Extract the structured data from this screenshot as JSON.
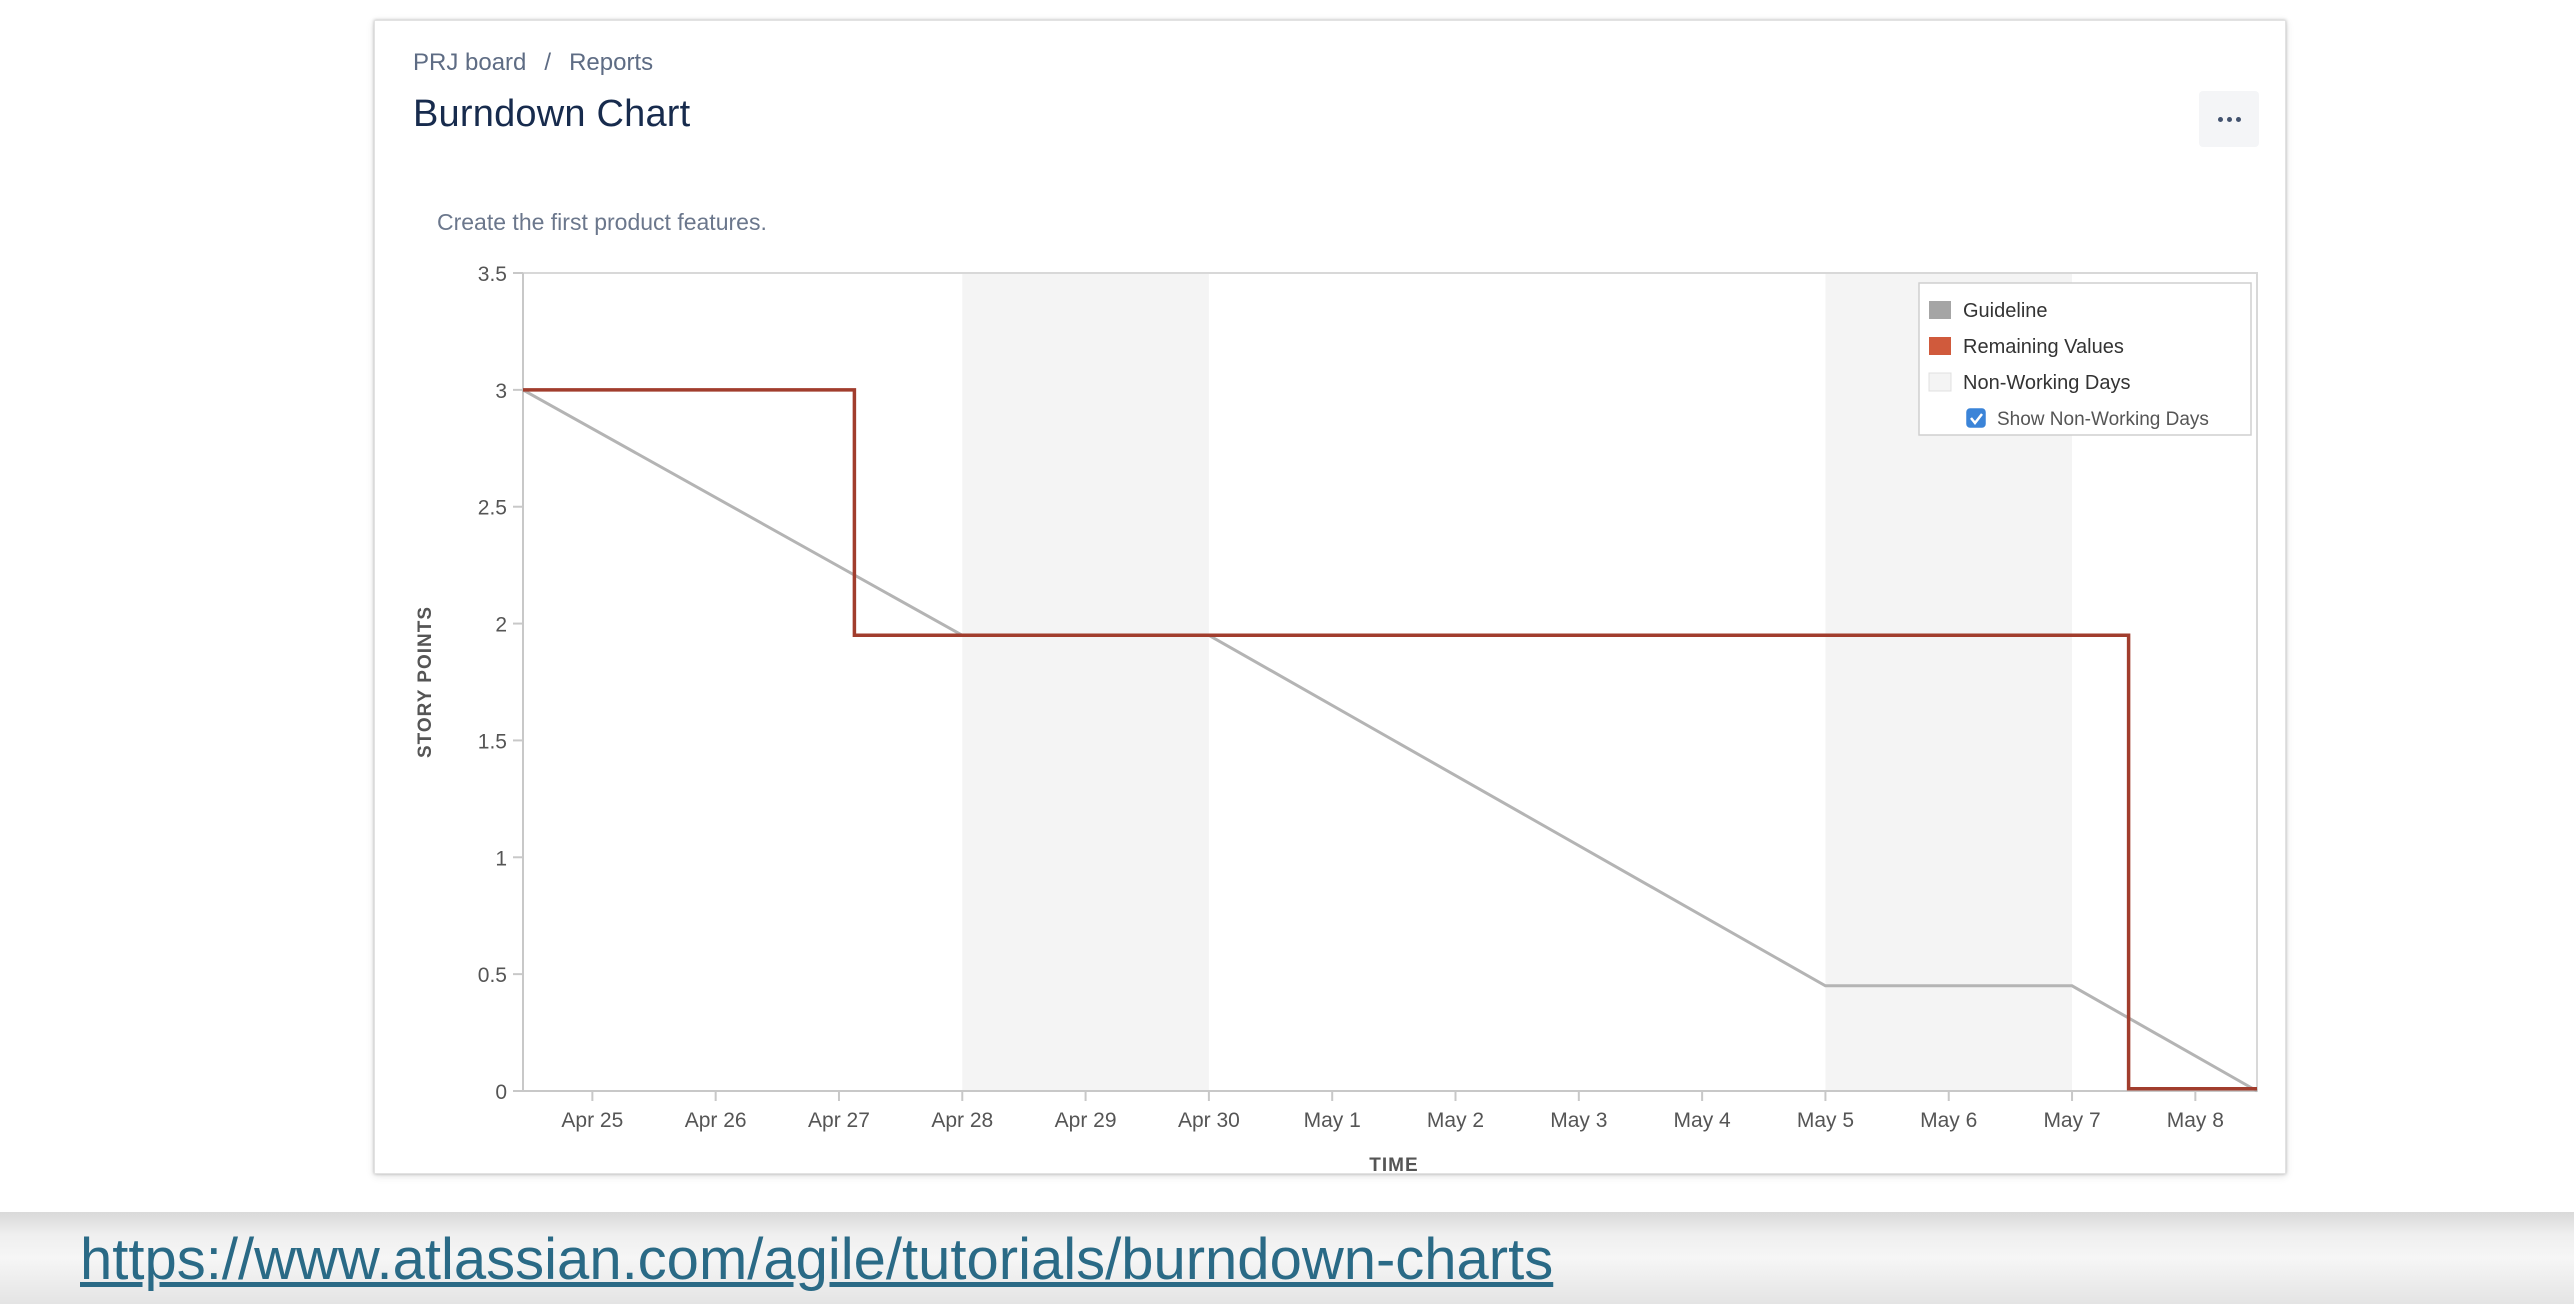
{
  "breadcrumb": {
    "board": "PRJ board",
    "separator": "/",
    "reports": "Reports"
  },
  "page": {
    "title": "Burndown Chart",
    "subtitle": "Create the first product features."
  },
  "footer": {
    "link": "https://www.atlassian.com/agile/tutorials/burndown-charts"
  },
  "colors": {
    "guideline": "#b4b4b4",
    "remaining": "#a13d2d",
    "remaining_swatch": "#d05a3c",
    "guideline_swatch": "#a5a5a5",
    "non_working": "#f4f4f4",
    "checkbox": "#3b84d8"
  },
  "chart_data": {
    "type": "line",
    "xlabel": "TIME",
    "ylabel": "STORY POINTS",
    "ylim": [
      0,
      3.5
    ],
    "xlim": [
      "Apr 24 10:30",
      "May 8 12:00"
    ],
    "yticks": [
      0,
      0.5,
      1,
      1.5,
      2,
      2.5,
      3,
      3.5
    ],
    "xticks": [
      "Apr 25",
      "Apr 26",
      "Apr 27",
      "Apr 28",
      "Apr 29",
      "Apr 30",
      "May 1",
      "May 2",
      "May 3",
      "May 4",
      "May 5",
      "May 6",
      "May 7",
      "May 8"
    ],
    "non_working_days": [
      [
        "Apr 28",
        "Apr 30"
      ],
      [
        "May 5",
        "May 7"
      ]
    ],
    "legend": {
      "position": "top-right",
      "entries": [
        "Guideline",
        "Remaining Values",
        "Non-Working Days"
      ],
      "checkbox_label": "Show Non-Working Days",
      "checkbox_checked": true
    },
    "series": [
      {
        "name": "Guideline",
        "points": [
          {
            "x": "Apr 24 10:30",
            "y": 3
          },
          {
            "x": "Apr 28",
            "y": 1.95
          },
          {
            "x": "Apr 30",
            "y": 1.95
          },
          {
            "x": "May 5",
            "y": 0.45
          },
          {
            "x": "May 7",
            "y": 0.45
          },
          {
            "x": "May 8 12:00",
            "y": 0
          }
        ]
      },
      {
        "name": "Remaining Values",
        "points": [
          {
            "x": "Apr 24 10:30",
            "y": 3
          },
          {
            "x": "Apr 27 03:00",
            "y": 3
          },
          {
            "x": "Apr 27 03:00",
            "y": 1.95
          },
          {
            "x": "May 7 11:00",
            "y": 1.95
          },
          {
            "x": "May 7 11:00",
            "y": 0.01
          },
          {
            "x": "May 8 12:00",
            "y": 0.01
          }
        ]
      }
    ]
  }
}
